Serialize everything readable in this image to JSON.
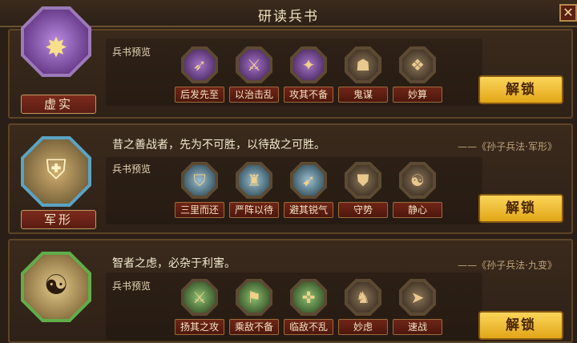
{
  "window": {
    "title": "研读兵书",
    "close_glyph": "✕"
  },
  "preview_label": "兵书预览",
  "unlock_label": "解锁",
  "books": [
    {
      "name": "虚实",
      "quote": "",
      "source": "",
      "color": "#7a3fa0",
      "skills": [
        {
          "label": "后发先至",
          "icon": "swoosh-icon"
        },
        {
          "label": "以治击乱",
          "icon": "warrior-icon"
        },
        {
          "label": "攻其不备",
          "icon": "strike-icon"
        },
        {
          "label": "鬼谋",
          "icon": "strategist-icon"
        },
        {
          "label": "妙算",
          "icon": "scroll-icon"
        }
      ]
    },
    {
      "name": "军形",
      "quote": "昔之善战者，先为不可胜，以待敌之可胜。",
      "source": "——《孙子兵法·军形》",
      "color": "#2f7fa8",
      "skills": [
        {
          "label": "三里而还",
          "icon": "retreat-icon"
        },
        {
          "label": "严阵以待",
          "icon": "formation-icon"
        },
        {
          "label": "避其锐气",
          "icon": "evade-icon"
        },
        {
          "label": "守势",
          "icon": "guard-icon"
        },
        {
          "label": "静心",
          "icon": "meditate-icon"
        }
      ]
    },
    {
      "name": "九变",
      "quote": "智者之虑，必杂于利害。",
      "source": "——《孙子兵法·九变》",
      "color": "#3f8a2f",
      "skills": [
        {
          "label": "扬其之攻",
          "icon": "attack-icon"
        },
        {
          "label": "乘敌不备",
          "icon": "ambush-icon"
        },
        {
          "label": "临敌不乱",
          "icon": "calm-icon"
        },
        {
          "label": "妙虑",
          "icon": "thinker-icon"
        },
        {
          "label": "速战",
          "icon": "charge-icon"
        }
      ]
    }
  ]
}
